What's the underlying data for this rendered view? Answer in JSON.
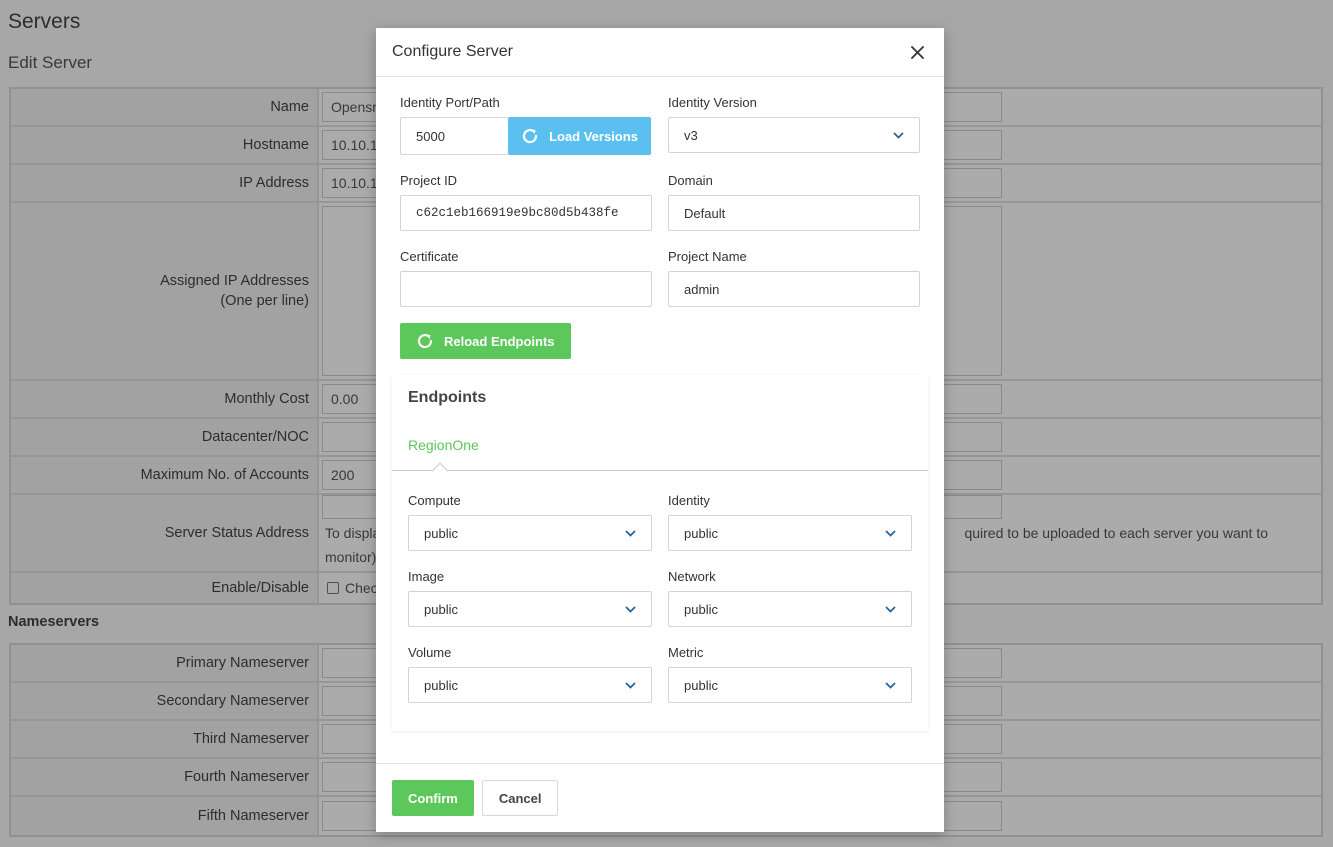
{
  "background": {
    "page_title": "Servers",
    "subtitle": "Edit Server",
    "rows": {
      "name_label": "Name",
      "name_value": "Opensr",
      "hostname_label": "Hostname",
      "hostname_value": "10.10.1",
      "ip_label": "IP Address",
      "ip_value": "10.10.1",
      "assigned_ip_label": "Assigned IP Addresses",
      "assigned_ip_hint": "(One per line)",
      "monthly_cost_label": "Monthly Cost",
      "monthly_cost_value": "0.00",
      "datacenter_label": "Datacenter/NOC",
      "max_accounts_label": "Maximum No. of Accounts",
      "max_accounts_value": "200",
      "status_address_label": "Server Status Address",
      "status_help_left": "To displa",
      "status_help_left2": "monitor)",
      "status_help_right": "quired to be uploaded to each server you want to",
      "enable_label": "Enable/Disable",
      "enable_check_text": "Check"
    },
    "nameservers_heading": "Nameservers",
    "nameservers": [
      "Primary Nameserver",
      "Secondary Nameserver",
      "Third Nameserver",
      "Fourth Nameserver",
      "Fifth Nameserver"
    ]
  },
  "modal": {
    "title": "Configure Server",
    "identity_port_label": "Identity Port/Path",
    "identity_port_value": "5000",
    "load_versions_label": "Load Versions",
    "identity_version_label": "Identity Version",
    "identity_version_value": "v3",
    "project_id_label": "Project ID",
    "project_id_value": "c62c1eb166919e9bc80d5b438fe",
    "domain_label": "Domain",
    "domain_value": "Default",
    "certificate_label": "Certificate",
    "certificate_value": "",
    "project_name_label": "Project Name",
    "project_name_value": "admin",
    "reload_endpoints_label": "Reload Endpoints",
    "endpoints": {
      "title": "Endpoints",
      "region_tab": "RegionOne",
      "fields": {
        "compute_label": "Compute",
        "compute_value": "public",
        "identity_label": "Identity",
        "identity_value": "public",
        "image_label": "Image",
        "image_value": "public",
        "network_label": "Network",
        "network_value": "public",
        "volume_label": "Volume",
        "volume_value": "public",
        "metric_label": "Metric",
        "metric_value": "public"
      }
    },
    "confirm_label": "Confirm",
    "cancel_label": "Cancel"
  },
  "colors": {
    "accent_green": "#5cc75a",
    "info_blue": "#5bc0f0",
    "chevron_blue": "#2a6496"
  }
}
